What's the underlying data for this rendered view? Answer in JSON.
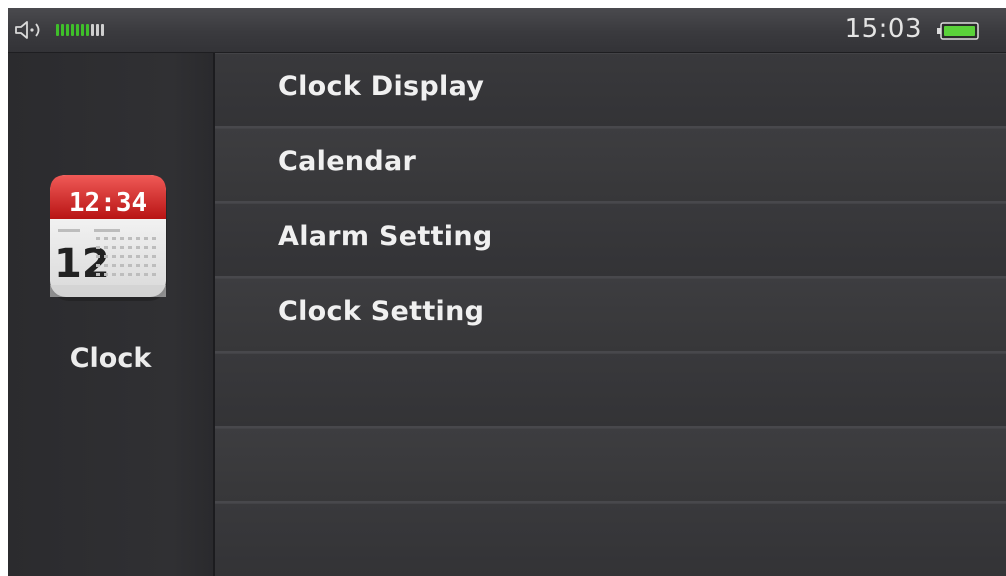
{
  "status_bar": {
    "time": "15:03",
    "icons": {
      "volume": "speaker-icon",
      "battery": "battery-icon"
    },
    "volume_level": {
      "filled": 7,
      "total": 10
    },
    "colors": {
      "volume_on": "#3fbf2a",
      "volume_off": "#cfcfcf",
      "battery_fill": "#5ad13a"
    }
  },
  "sidebar": {
    "app_icon": "calendar-clock-icon",
    "app_icon_time": "12:34",
    "app_icon_date": "12",
    "app_label": "Clock"
  },
  "menu": {
    "items": [
      {
        "label": "Clock Display"
      },
      {
        "label": "Calendar"
      },
      {
        "label": "Alarm Setting"
      },
      {
        "label": "Clock Setting"
      },
      {
        "label": ""
      },
      {
        "label": ""
      },
      {
        "label": ""
      }
    ]
  }
}
